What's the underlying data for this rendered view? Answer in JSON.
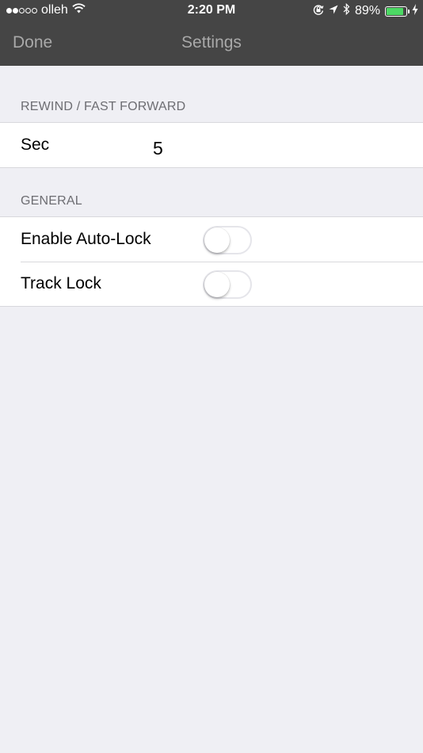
{
  "status_bar": {
    "carrier": "olleh",
    "signal_bars_filled": 2,
    "signal_bars_total": 5,
    "time": "2:20 PM",
    "battery_percent": "89%",
    "battery_level": 0.89,
    "icons": [
      "wifi-icon",
      "rotation-lock-icon",
      "location-arrow-icon",
      "bluetooth-icon",
      "battery-icon",
      "charging-bolt-icon"
    ],
    "battery_color": "#4cd964"
  },
  "nav": {
    "done_label": "Done",
    "title": "Settings"
  },
  "sections": {
    "rewind": {
      "header": "REWIND / FAST FORWARD",
      "sec_label": "Sec",
      "sec_value": "5"
    },
    "general": {
      "header": "GENERAL",
      "auto_lock_label": "Enable Auto-Lock",
      "auto_lock_on": false,
      "track_lock_label": "Track Lock",
      "track_lock_on": false
    }
  },
  "colors": {
    "nav_background": "#454545",
    "nav_text": "#a9a9a9",
    "page_background": "#efeff4",
    "section_header_text": "#6d6d72"
  }
}
